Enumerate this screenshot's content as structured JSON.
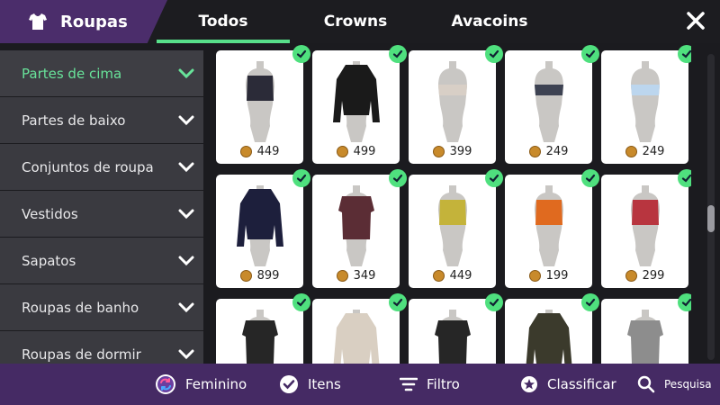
{
  "header": {
    "title": "Roupas",
    "tabs": [
      {
        "label": "Todos",
        "active": true
      },
      {
        "label": "Crowns",
        "active": false
      },
      {
        "label": "Avacoins",
        "active": false
      }
    ]
  },
  "sidebar": {
    "items": [
      {
        "label": "Partes de cima",
        "active": true
      },
      {
        "label": "Partes de baixo",
        "active": false
      },
      {
        "label": "Conjuntos de roupa",
        "active": false
      },
      {
        "label": "Vestidos",
        "active": false
      },
      {
        "label": "Sapatos",
        "active": false
      },
      {
        "label": "Roupas de banho",
        "active": false
      },
      {
        "label": "Roupas de dormir",
        "active": false
      }
    ]
  },
  "items": [
    {
      "price": "449",
      "color": "#2b2b38",
      "style": "crop",
      "owned": true
    },
    {
      "price": "499",
      "color": "#1a1a1a",
      "style": "hoodie",
      "owned": true
    },
    {
      "price": "399",
      "color": "#d8cfc6",
      "style": "bra",
      "owned": true
    },
    {
      "price": "249",
      "color": "#3d4252",
      "style": "bandeau",
      "owned": true
    },
    {
      "price": "249",
      "color": "#bcd6ee",
      "style": "bandeau",
      "owned": true
    },
    {
      "price": "899",
      "color": "#1d1f3c",
      "style": "jacket",
      "owned": true
    },
    {
      "price": "349",
      "color": "#5b2d35",
      "style": "plaid",
      "owned": true
    },
    {
      "price": "449",
      "color": "#c4b33a",
      "style": "cami",
      "owned": true
    },
    {
      "price": "199",
      "color": "#e06a1f",
      "style": "pumpkin",
      "owned": true
    },
    {
      "price": "299",
      "color": "#b8353f",
      "style": "ruffle",
      "owned": true
    },
    {
      "price": "",
      "color": "#262626",
      "style": "tee",
      "owned": true
    },
    {
      "price": "",
      "color": "#d9cfc2",
      "style": "sweater",
      "owned": true
    },
    {
      "price": "",
      "color": "#262626",
      "style": "wrap",
      "owned": true
    },
    {
      "price": "",
      "color": "#3b3a2c",
      "style": "camo-jacket",
      "owned": true
    },
    {
      "price": "",
      "color": "#8d8d8d",
      "style": "camo-tee",
      "owned": true
    }
  ],
  "footer": {
    "gender_label": "Feminino",
    "items_label": "Itens",
    "filter_label": "Filtro",
    "sort_label": "Classificar",
    "search_label": "Pesquisa"
  },
  "colors": {
    "accent": "#58e08a",
    "brand": "#4b2d6b",
    "footer": "#452a64",
    "sidebar": "#3a3a40"
  }
}
